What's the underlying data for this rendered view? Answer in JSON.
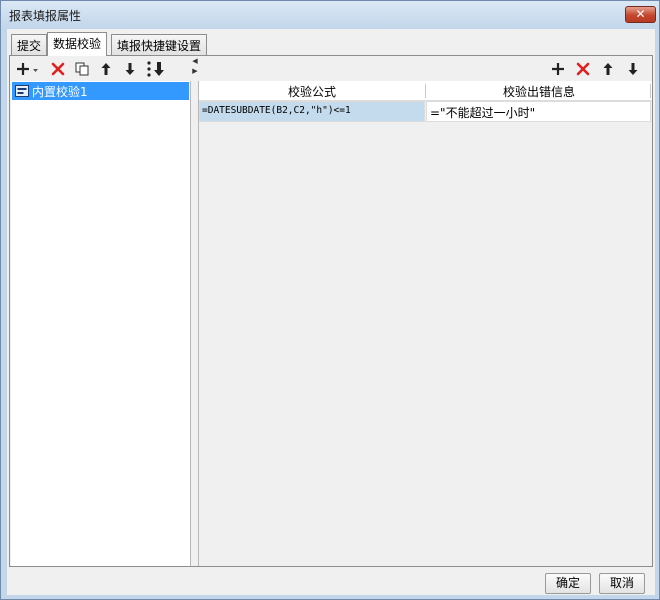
{
  "window": {
    "title": "报表填报属性",
    "close_glyph": "✕"
  },
  "tabs": [
    {
      "label": "提交",
      "active": false
    },
    {
      "label": "数据校验",
      "active": true
    },
    {
      "label": "填报快捷键设置",
      "active": false
    }
  ],
  "left_toolbar": {
    "icons": [
      "add-dropdown-icon",
      "delete-icon",
      "copy-icon",
      "move-up-icon",
      "move-down-icon",
      "move-bottom-icon"
    ]
  },
  "left_list": {
    "items": [
      {
        "label": "内置校验1",
        "icon": "validation-item-icon",
        "selected": true
      }
    ]
  },
  "right_toolbar": {
    "icons": [
      "add-icon",
      "delete-icon",
      "move-up-icon",
      "move-down-icon"
    ]
  },
  "grid": {
    "headers": [
      "校验公式",
      "校验出错信息"
    ],
    "rows": [
      {
        "formula": "=DATESUBDATE(B2,C2,\"h\")<=1",
        "message": "=\"不能超过一小时\""
      }
    ]
  },
  "footer": {
    "ok_label": "确定",
    "cancel_label": "取消"
  },
  "colors": {
    "selection": "#3399ff",
    "selected_cell": "#c3dbec",
    "delete_red": "#e02020"
  }
}
